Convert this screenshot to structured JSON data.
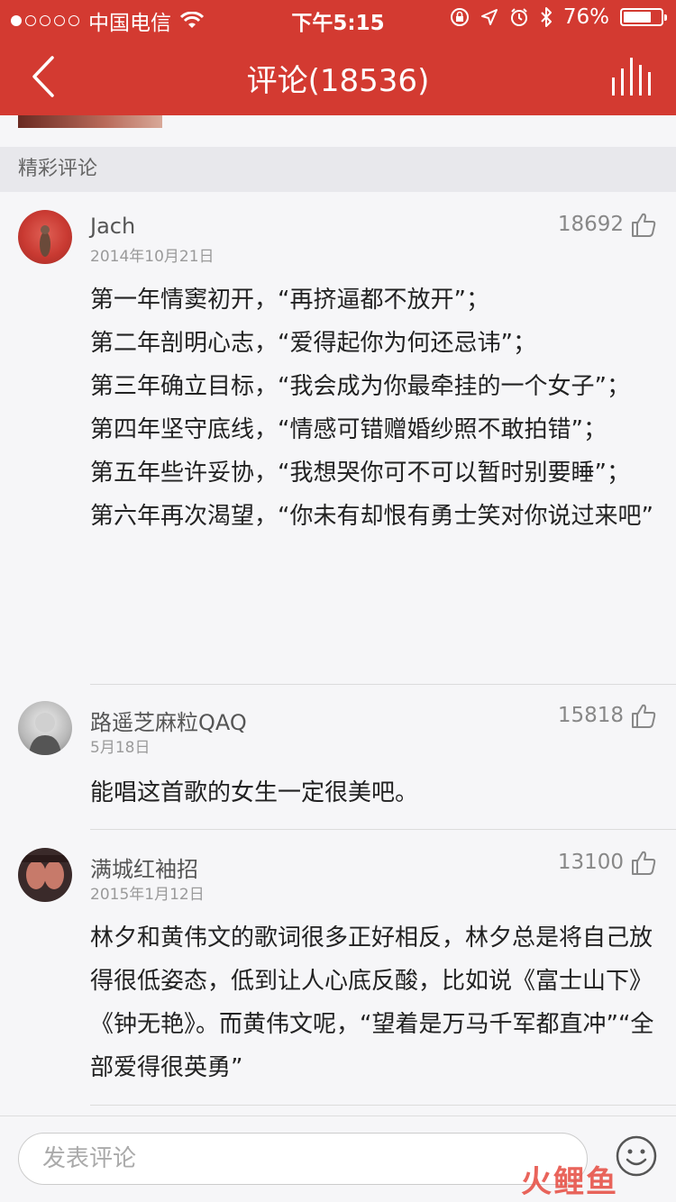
{
  "status_bar": {
    "carrier": "中国电信",
    "time": "下午5:15",
    "battery": "76%",
    "battery_level": 0.76,
    "icons": [
      "wifi-icon",
      "lock-rotation-icon",
      "location-icon",
      "alarm-icon",
      "bluetooth-icon",
      "battery-icon"
    ]
  },
  "nav": {
    "title": "评论(18536)",
    "back_icon": "chevron-left-icon",
    "right_icon": "bar-chart-icon"
  },
  "section": {
    "title": "精彩评论"
  },
  "comments": [
    {
      "username": "Jach",
      "date": "2014年10月21日",
      "likes": "18692",
      "text": "第一年情窦初开，“再挤逼都不放开”；\n第二年剖明心志，“爱得起你为何还忌讳”；\n第三年确立目标，“我会成为你最牵挂的一个女子”；\n第四年坚守底线，“情感可错赠婚纱照不敢拍错”；\n第五年些许妥协，“我想哭你可不可以暂时别要睡”；\n第六年再次渴望，“你未有却恨有勇士笑对你说过来吧”"
    },
    {
      "username": "路遥芝麻粒QAQ",
      "date": "5月18日",
      "likes": "15818",
      "text": "能唱这首歌的女生一定很美吧。"
    },
    {
      "username": "满城红袖招",
      "date": "2015年1月12日",
      "likes": "13100",
      "text": "林夕和黄伟文的歌词很多正好相反，林夕总是将自己放得很低姿态，低到让人心底反酸，比如说《富士山下》《钟无艳》。而黄伟文呢，“望着是万马千军都直冲”“全部爱得很英勇”"
    }
  ],
  "composer": {
    "placeholder": "发表评论",
    "emoji_icon": "smiley-icon"
  },
  "watermark": "火鲤鱼",
  "colors": {
    "brand": "#d33a31",
    "background": "#f6f6f8"
  }
}
